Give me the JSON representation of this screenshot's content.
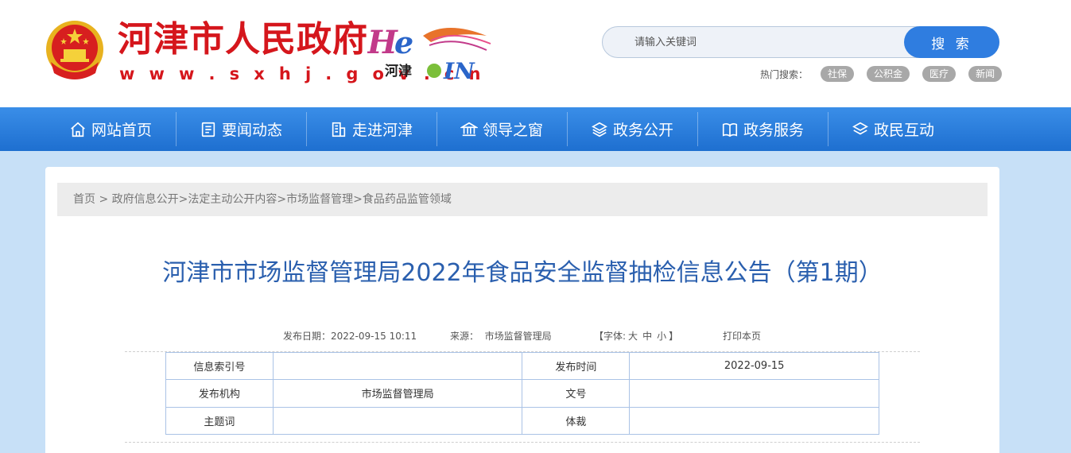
{
  "header": {
    "site_title": "河津市人民政府",
    "site_url": "w w w . s x h j . g o v . c n",
    "logo_cn": "河津",
    "brand_color": "#d5161c"
  },
  "search": {
    "placeholder": "请输入关键词",
    "button_label": "搜 索",
    "hot_label": "热门搜索：",
    "hot_tags": [
      "社保",
      "公积金",
      "医疗",
      "新闻"
    ]
  },
  "nav": {
    "color": "#2a7de1",
    "items": [
      {
        "label": "网站首页",
        "icon": "home-icon"
      },
      {
        "label": "要闻动态",
        "icon": "news-icon"
      },
      {
        "label": "走进河津",
        "icon": "building-icon"
      },
      {
        "label": "领导之窗",
        "icon": "government-icon"
      },
      {
        "label": "政务公开",
        "icon": "layers-icon"
      },
      {
        "label": "政务服务",
        "icon": "book-icon"
      },
      {
        "label": "政民互动",
        "icon": "stack-icon"
      }
    ]
  },
  "breadcrumb": {
    "items": [
      "首页",
      "政府信息公开",
      "法定主动公开内容",
      "市场监督管理",
      "食品药品监管领域"
    ],
    "sep1": " > ",
    "sep": ">"
  },
  "article": {
    "title": "河津市市场监督管理局2022年食品安全监督抽检信息公告（第1期）",
    "date_label": "发布日期：",
    "date": "2022-09-15 10:11",
    "source_label": "来源：",
    "source": "市场监督管理局",
    "font_label_open": "【字体:",
    "font_large": "大",
    "font_medium": "中",
    "font_small": "小",
    "font_label_close": "】",
    "print": "打印本页"
  },
  "info_table": {
    "rows": [
      {
        "l1": "信息索引号",
        "v1": "",
        "l2": "发布时间",
        "v2": "2022-09-15"
      },
      {
        "l1": "发布机构",
        "v1": "市场监督管理局",
        "l2": "文号",
        "v2": ""
      },
      {
        "l1": "主题词",
        "v1": "",
        "l2": "体裁",
        "v2": ""
      }
    ]
  }
}
